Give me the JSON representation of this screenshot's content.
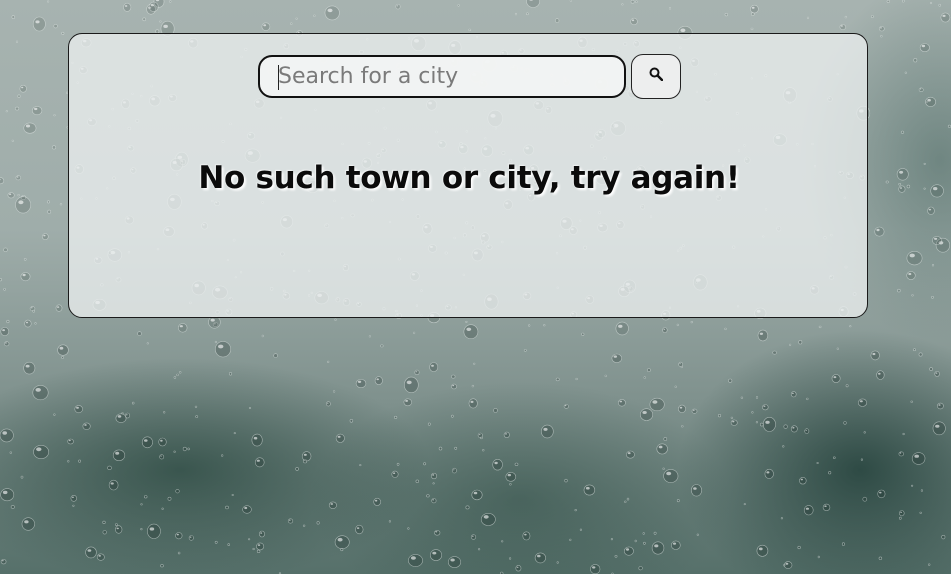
{
  "search": {
    "placeholder": "Search for a city",
    "value": "",
    "button_icon": "search-icon"
  },
  "message": {
    "text": "No such town or city, try again!"
  },
  "background": {
    "description_icon": "raindrops-window-background"
  }
}
